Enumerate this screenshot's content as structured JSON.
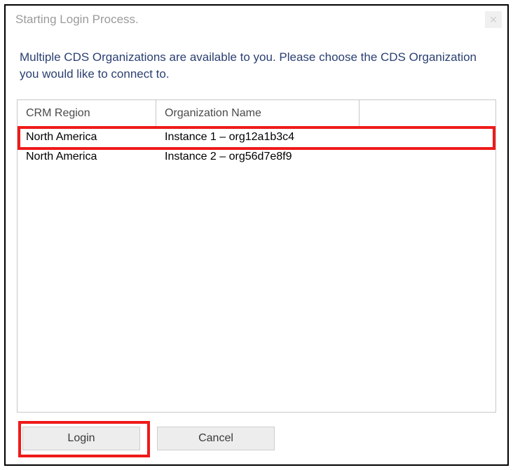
{
  "window": {
    "title": "Starting Login Process."
  },
  "instructions": "Multiple CDS Organizations are available to you. Please choose the CDS Organization you would like to connect to.",
  "grid": {
    "headers": {
      "region": "CRM Region",
      "orgName": "Organization Name"
    },
    "rows": [
      {
        "region": "North America",
        "orgName": "Instance 1 – org12a1b3c4"
      },
      {
        "region": "North America",
        "orgName": "Instance 2 – org56d7e8f9"
      }
    ]
  },
  "buttons": {
    "login": "Login",
    "cancel": "Cancel"
  }
}
